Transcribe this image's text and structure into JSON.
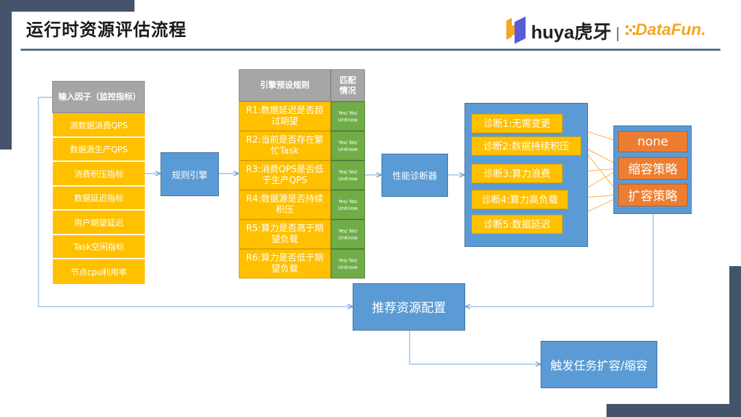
{
  "slide": {
    "title": "运行时资源评估流程",
    "logos": {
      "huya": "huya虎牙",
      "separator": "|",
      "datafun": "DataFun."
    },
    "colors": {
      "accent_blue": "#5b9bd5",
      "yellow": "#ffc000",
      "green": "#70ad47",
      "orange": "#ed7d31",
      "grey": "#a6a6a6",
      "frame": "#44546a"
    }
  },
  "inputs": {
    "header": "输入因子（监控指标）",
    "items": [
      "源数据消费QPS",
      "数据源生产QPS",
      "消费积压指标",
      "数据延迟指标",
      "用户期望延迟",
      "Task空闲指标",
      "节点cpu利用率"
    ]
  },
  "rule_engine": {
    "label": "规则引擎"
  },
  "rules": {
    "header": "引擎预设规则",
    "match_header": "匹配情况",
    "items": [
      {
        "text": "R1:数据延迟是否超过期望",
        "match": "Yes/ No/ UnKnow"
      },
      {
        "text": "R2:当前是否存在繁忙Task",
        "match": "Yes/ No/ UnKnow"
      },
      {
        "text": "R3:消费QPS是否低于生产QPS",
        "match": "Yes/ No/ UnKnow"
      },
      {
        "text": "R4:数据源是否持续积压",
        "match": "Yes/ No/ UnKnow"
      },
      {
        "text": "R5:算力是否高于期望负载",
        "match": "Yes/ No/ UnKnow"
      },
      {
        "text": "R6:算力是否低于期望负载",
        "match": "Yes/ No/ UnKnow"
      }
    ]
  },
  "diagnoser": {
    "label": "性能诊断器"
  },
  "diagnoses": [
    "诊断1:无需变更",
    "诊断2:数据持续积压",
    "诊断3:算力浪费",
    "诊断4:算力高负载",
    "诊断5:数据延迟"
  ],
  "outcomes": [
    "none",
    "缩容策略",
    "扩容策略"
  ],
  "recommend": {
    "label": "推荐资源配置"
  },
  "trigger": {
    "label": "触发任务扩容/缩容"
  }
}
